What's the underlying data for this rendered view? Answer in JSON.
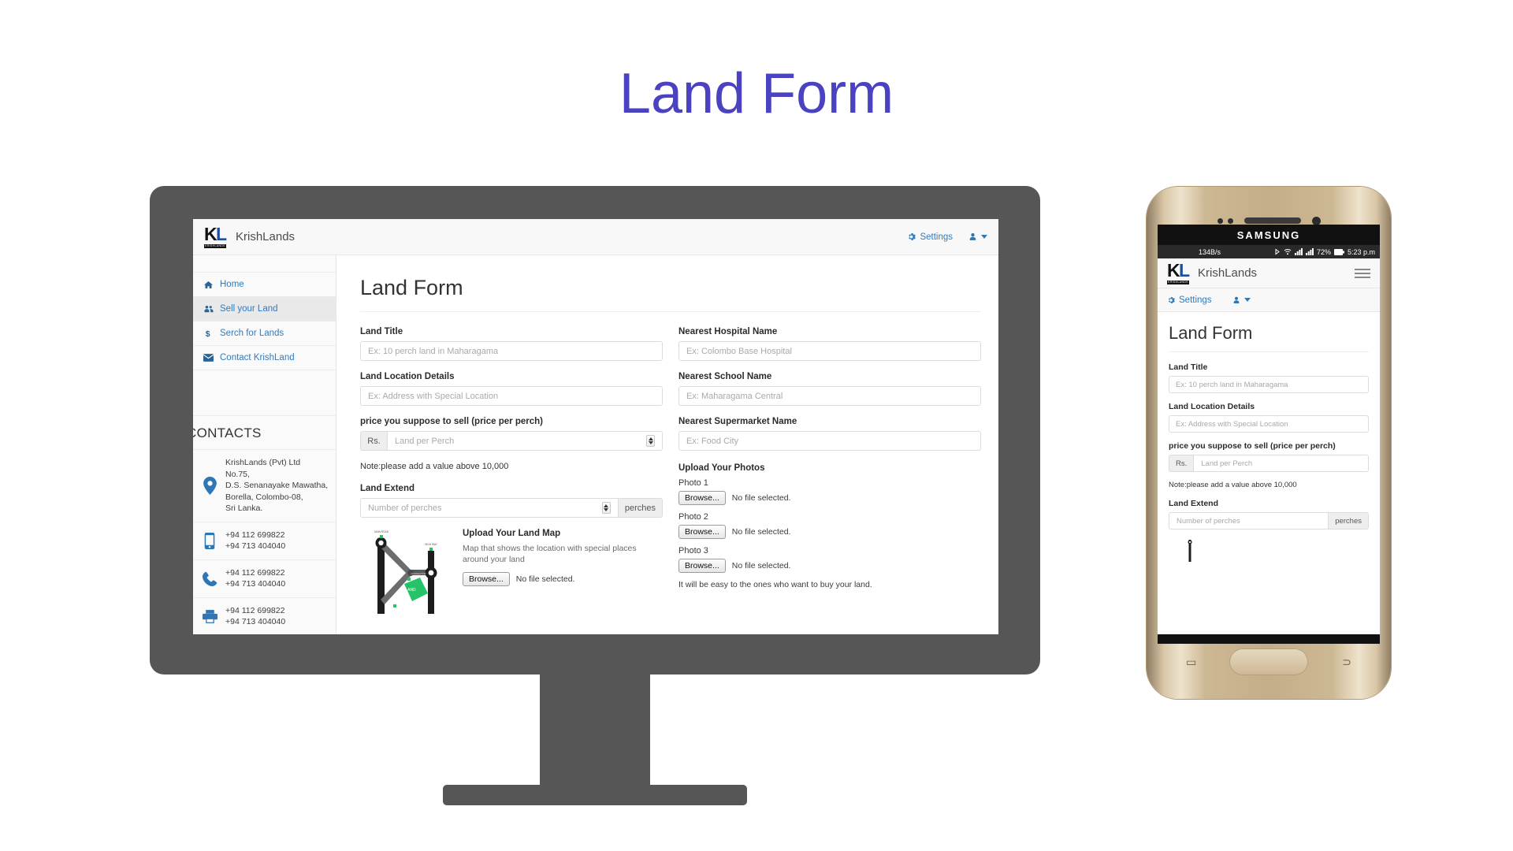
{
  "page": {
    "title": "Land Form",
    "title_color": "#4a42c0"
  },
  "app": {
    "brand": "KrishLands",
    "logo": {
      "k": "K",
      "l": "L",
      "bar_text": "KRISHLANDS"
    },
    "navbar": {
      "settings_label": "Settings",
      "settings_icon": "gear-icon",
      "user_icon": "user-icon",
      "caret_icon": "caret-down-icon"
    },
    "sidebar": {
      "items": [
        {
          "label": "Home",
          "icon": "home-icon",
          "active": false
        },
        {
          "label": "Sell your Land",
          "icon": "sell-land-icon",
          "active": true
        },
        {
          "label": "Serch for Lands",
          "icon": "dollar-icon",
          "active": false
        },
        {
          "label": "Contact KrishLand",
          "icon": "envelope-icon",
          "active": false
        }
      ],
      "contacts_heading": "CONTACTS",
      "contacts": [
        {
          "icon": "map-marker-icon",
          "lines": [
            "KrishLands (Pvt) Ltd",
            "No.75,",
            "D.S. Senanayake Mawatha,",
            "Borella, Colombo-08,",
            "Sri Lanka."
          ]
        },
        {
          "icon": "mobile-phone-icon",
          "lines": [
            "+94 112 699822",
            "+94 713 404040"
          ]
        },
        {
          "icon": "telephone-icon",
          "lines": [
            "+94 112 699822",
            "+94 713 404040"
          ]
        },
        {
          "icon": "printer-icon",
          "lines": [
            "+94 112 699822",
            "+94 713 404040"
          ]
        }
      ]
    },
    "form": {
      "heading": "Land Form",
      "left": {
        "land_title_label": "Land Title",
        "land_title_placeholder": "Ex: 10 perch land in Maharagama",
        "land_location_label": "Land Location Details",
        "land_location_placeholder": "Ex: Address with Special Location",
        "price_label": "price you suppose to sell (price per perch)",
        "price_addon": "Rs.",
        "price_placeholder": "Land per Perch",
        "price_note": "Note:please add a value above 10,000",
        "extent_label": "Land Extend",
        "extent_placeholder": "Number of perches",
        "extent_addon": "perches",
        "map_heading": "Upload Your Land Map",
        "map_description": "Map that shows the location with special places around your land",
        "map_browse_label": "Browse...",
        "map_file_status": "No file selected.",
        "map_image_label": "LAND"
      },
      "right": {
        "hospital_label": "Nearest Hospital Name",
        "hospital_placeholder": "Ex: Colombo Base Hospital",
        "school_label": "Nearest School Name",
        "school_placeholder": "Ex: Maharagama Central",
        "supermarket_label": "Nearest Supermarket Name",
        "supermarket_placeholder": "Ex: Food City",
        "upload_heading": "Upload Your Photos",
        "photos": [
          {
            "label": "Photo 1",
            "browse_label": "Browse...",
            "status": "No file selected."
          },
          {
            "label": "Photo 2",
            "browse_label": "Browse...",
            "status": "No file selected."
          },
          {
            "label": "Photo 3",
            "browse_label": "Browse...",
            "status": "No file selected."
          }
        ],
        "footer_note": "It will be easy to the ones who want to buy your land."
      }
    }
  },
  "phone": {
    "brand_text": "SAMSUNG",
    "status": {
      "network_speed": "134B/s",
      "battery": "72%",
      "time": "5:23 p.m"
    },
    "navbar_brand": "KrishLands",
    "menu_icon": "hamburger-icon",
    "settings_label": "Settings",
    "form": {
      "heading": "Land Form",
      "land_title_label": "Land Title",
      "land_title_placeholder": "Ex: 10 perch land in Maharagama",
      "land_location_label": "Land Location Details",
      "land_location_placeholder": "Ex: Address with Special Location",
      "price_label": "price you suppose to sell (price per perch)",
      "price_addon": "Rs.",
      "price_placeholder": "Land per Perch",
      "price_note": "Note:please add a value above 10,000",
      "extent_label": "Land Extend",
      "extent_placeholder": "Number of perches",
      "extent_addon": "perches"
    }
  }
}
